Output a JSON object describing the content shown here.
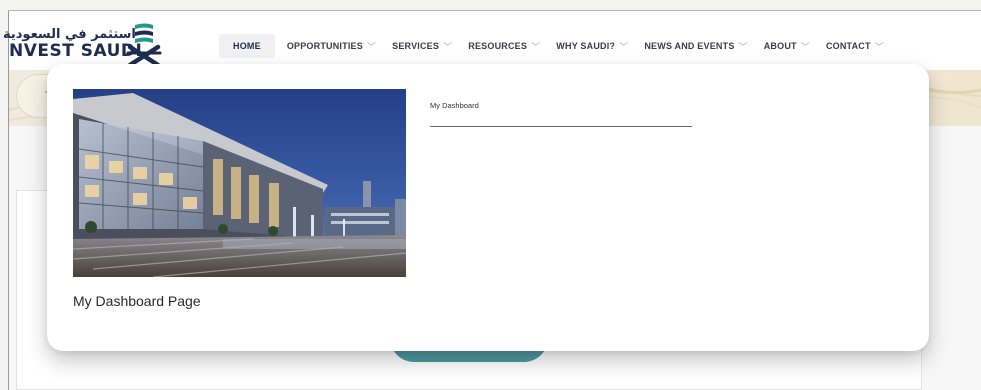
{
  "logo": {
    "arabic": "استثمر في السعودية",
    "english": "NVEST SAUDI",
    "mark": "invest-saudi-logo-mark"
  },
  "nav": {
    "items": [
      {
        "label": "HOME",
        "active": true,
        "has_dropdown": false
      },
      {
        "label": "OPPORTUNITIES",
        "has_dropdown": true
      },
      {
        "label": "SERVICES",
        "has_dropdown": true
      },
      {
        "label": "RESOURCES",
        "has_dropdown": true
      },
      {
        "label": "WHY SAUDI?",
        "has_dropdown": true
      },
      {
        "label": "NEWS AND EVENTS",
        "has_dropdown": true
      },
      {
        "label": "ABOUT",
        "has_dropdown": true
      },
      {
        "label": "CONTACT",
        "has_dropdown": true
      }
    ],
    "chevron": "﹀"
  },
  "dropdown": {
    "image": "modern-glass-office-building-at-dusk",
    "caption": "My Dashboard Page",
    "link": "My Dashboard"
  },
  "colors": {
    "brand_navy": "#1e2d4f",
    "teal": "#4d9aa0",
    "gold": "#c59b55",
    "sand": "#f0ebde"
  }
}
